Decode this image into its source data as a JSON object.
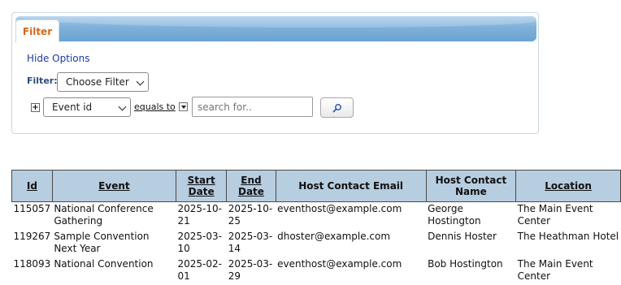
{
  "filter_panel": {
    "tab_label": "Filter",
    "hide_options": "Hide Options",
    "filter_label": "Filter:",
    "choose_filter": "Choose Filter",
    "field_select": "Event id",
    "operator": "equals to",
    "search": {
      "placeholder": "search for.."
    },
    "plus": "+"
  },
  "table": {
    "headers": [
      {
        "label": "Id",
        "linked": true
      },
      {
        "label": "Event",
        "linked": true
      },
      {
        "label": "Start Date",
        "linked": true
      },
      {
        "label": "End Date",
        "linked": true
      },
      {
        "label": "Host Contact Email",
        "linked": false
      },
      {
        "label": "Host Contact Name",
        "linked": false
      },
      {
        "label": "Location",
        "linked": true
      }
    ],
    "rows": [
      {
        "id": "115057",
        "event": "National Conference Gathering",
        "start": "2025-10-21",
        "end": "2025-10-25",
        "email": "eventhost@example.com",
        "name": "George Hostington",
        "location": "The Main Event Center"
      },
      {
        "id": "119267",
        "event": "Sample Convention Next Year",
        "start": "2025-03-10",
        "end": "2025-03-14",
        "email": "dhoster@example.com",
        "name": "Dennis Hoster",
        "location": "The Heathman Hotel"
      },
      {
        "id": "118093",
        "event": "National Convention",
        "start": "2025-02-01",
        "end": "2025-03-29",
        "email": "eventhost@example.com",
        "name": "Bob Hostington",
        "location": "The Main Event Center"
      }
    ]
  },
  "colors": {
    "tab_text": "#d2691e",
    "link": "#1a3aa6",
    "header_bg": "#b7cde0",
    "panel_header": "#7fb0d8"
  },
  "icons": [
    "plus-icon",
    "chevron-down-icon",
    "search-icon"
  ]
}
